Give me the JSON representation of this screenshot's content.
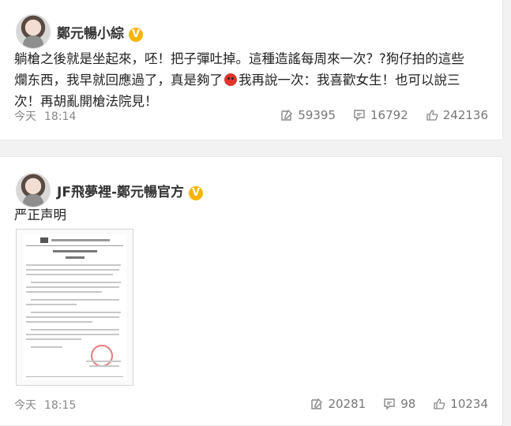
{
  "posts": [
    {
      "author": "鄭元暢小綜",
      "verified_badge": "V",
      "text_lines": [
        "躺槍之後就是坐起來，呸！把子彈吐掉。這種造謠每周來一次？?狗仔拍的這些",
        "爛东西，我早就回應過了，真是夠了",
        "我再說一次：我喜歡女生！也可以說三",
        "次！再胡亂開槍法院見！"
      ],
      "emoji": "angry-face",
      "date": "今天",
      "time": "18:14",
      "reposts": "59395",
      "comments": "16792",
      "likes": "242136"
    },
    {
      "author": "JF飛夢裡-鄭元暢官方",
      "verified_badge": "V",
      "text": "严正声明",
      "date": "今天",
      "time": "18:15",
      "reposts": "20281",
      "comments": "98",
      "likes": "10234"
    }
  ],
  "colors": {
    "background": "#f2f2f2",
    "card": "#ffffff",
    "badge": "#f7b500",
    "meta_text": "#888888"
  },
  "icons": [
    "repost-icon",
    "comment-icon",
    "like-icon",
    "verified-badge-icon",
    "angry-emoji-icon"
  ]
}
